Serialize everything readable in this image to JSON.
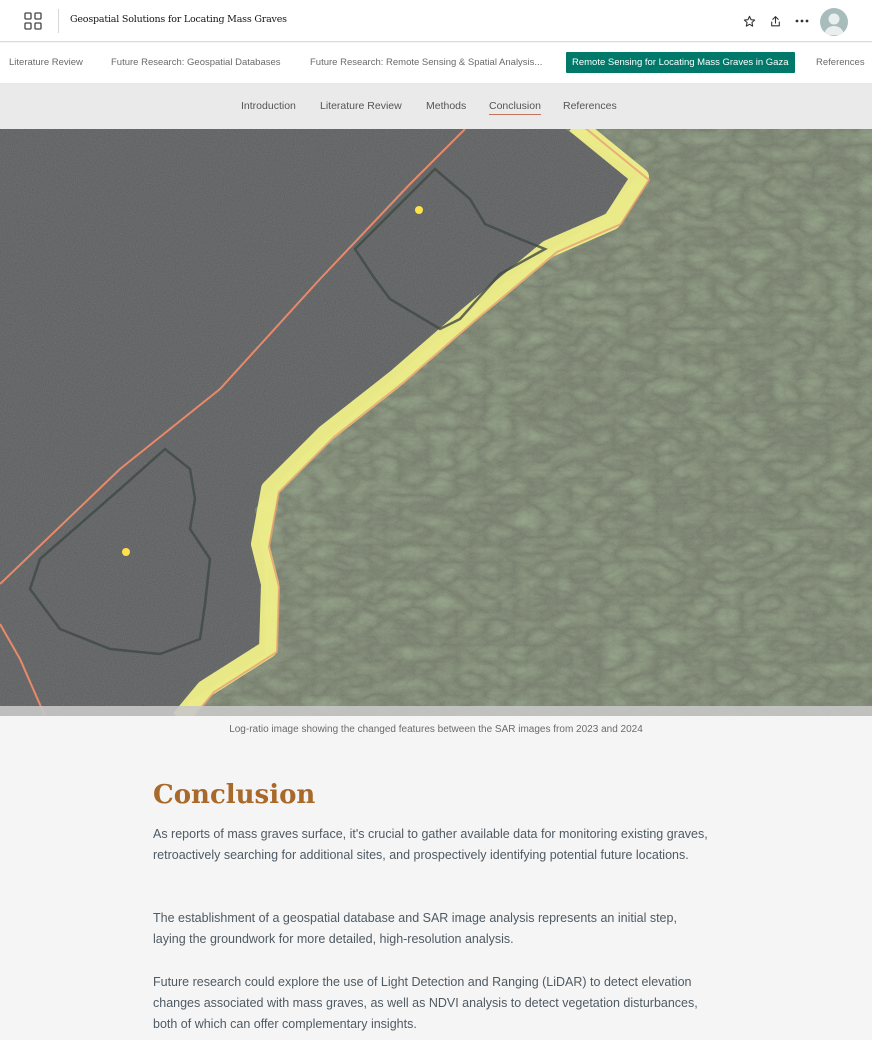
{
  "header": {
    "title": "Geospatial Solutions for Locating Mass Graves"
  },
  "story_tabs": [
    {
      "label": "Literature Review"
    },
    {
      "label": "Future Research: Geospatial Databases"
    },
    {
      "label": "Future Research: Remote Sensing & Spatial Analysis..."
    },
    {
      "label": "Remote Sensing for Locating Mass Graves in Gaza",
      "active": true
    },
    {
      "label": "References"
    }
  ],
  "section_nav": [
    {
      "label": "Introduction"
    },
    {
      "label": "Literature Review"
    },
    {
      "label": "Methods"
    },
    {
      "label": "Conclusion",
      "active": true
    },
    {
      "label": "References"
    }
  ],
  "map": {
    "caption": "Log-ratio image showing the changed features between the SAR images from 2023 and 2024"
  },
  "conclusion": {
    "heading": "Conclusion",
    "paragraphs": [
      "As reports of mass graves surface, it's crucial to gather available data for monitoring existing graves, retroactively searching for additional sites, and prospectively identifying potential future locations.",
      "The establishment of a geospatial database and SAR image analysis represents an initial step, laying the groundwork for more detailed, high-resolution analysis.",
      "Future research could explore the use of Light Detection and Ranging (LiDAR) to detect elevation changes associated with mass graves, as well as NDVI analysis to detect vegetation disturbances, both of which can offer complementary insights."
    ]
  },
  "colors": {
    "accent": "#00796b",
    "heading": "#a8692b",
    "nav_underline": "#c0735f",
    "border_highlight": "#f3f38a",
    "boundary_line": "#e88a6a"
  },
  "icons": [
    "apps-grid-icon",
    "favorite-star-icon",
    "share-icon",
    "more-options-icon",
    "user-avatar-icon"
  ]
}
